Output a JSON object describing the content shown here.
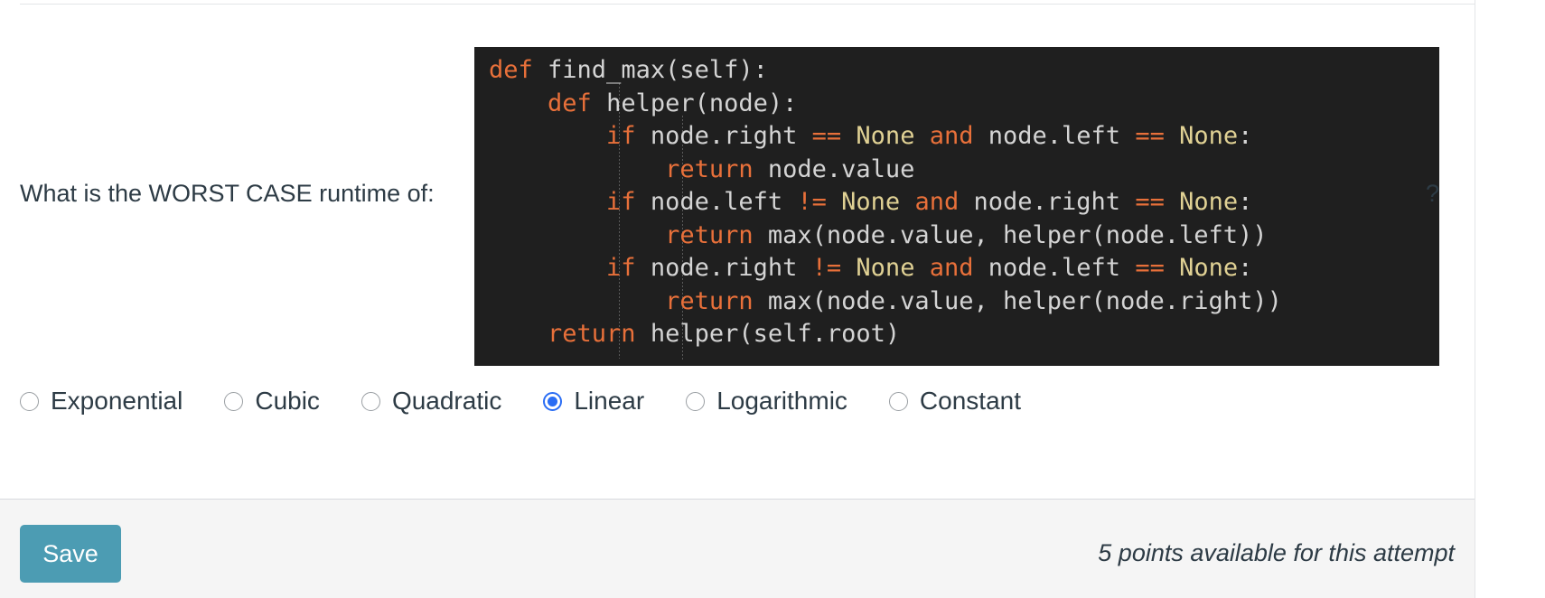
{
  "question": {
    "prefix": "What is the WORST CASE runtime of:",
    "suffix": "?"
  },
  "code": {
    "language": "python",
    "lines": [
      [
        {
          "t": "def",
          "c": "kw"
        },
        {
          "t": " find_max(self):",
          "c": "name"
        }
      ],
      [
        {
          "t": "    ",
          "c": "name"
        },
        {
          "t": "def",
          "c": "kw"
        },
        {
          "t": " helper(node):",
          "c": "name"
        }
      ],
      [
        {
          "t": "        ",
          "c": "name"
        },
        {
          "t": "if",
          "c": "kw"
        },
        {
          "t": " node.right ",
          "c": "name"
        },
        {
          "t": "==",
          "c": "op"
        },
        {
          "t": " ",
          "c": "name"
        },
        {
          "t": "None",
          "c": "none"
        },
        {
          "t": " ",
          "c": "name"
        },
        {
          "t": "and",
          "c": "kw"
        },
        {
          "t": " node.left ",
          "c": "name"
        },
        {
          "t": "==",
          "c": "op"
        },
        {
          "t": " ",
          "c": "name"
        },
        {
          "t": "None",
          "c": "none"
        },
        {
          "t": ":",
          "c": "name"
        }
      ],
      [
        {
          "t": "            ",
          "c": "name"
        },
        {
          "t": "return",
          "c": "kw"
        },
        {
          "t": " node.value",
          "c": "name"
        }
      ],
      [
        {
          "t": "        ",
          "c": "name"
        },
        {
          "t": "if",
          "c": "kw"
        },
        {
          "t": " node.left ",
          "c": "name"
        },
        {
          "t": "!=",
          "c": "op"
        },
        {
          "t": " ",
          "c": "name"
        },
        {
          "t": "None",
          "c": "none"
        },
        {
          "t": " ",
          "c": "name"
        },
        {
          "t": "and",
          "c": "kw"
        },
        {
          "t": " node.right ",
          "c": "name"
        },
        {
          "t": "==",
          "c": "op"
        },
        {
          "t": " ",
          "c": "name"
        },
        {
          "t": "None",
          "c": "none"
        },
        {
          "t": ":",
          "c": "name"
        }
      ],
      [
        {
          "t": "            ",
          "c": "name"
        },
        {
          "t": "return",
          "c": "kw"
        },
        {
          "t": " max(node.value, helper(node.left))",
          "c": "name"
        }
      ],
      [
        {
          "t": "        ",
          "c": "name"
        },
        {
          "t": "if",
          "c": "kw"
        },
        {
          "t": " node.right ",
          "c": "name"
        },
        {
          "t": "!=",
          "c": "op"
        },
        {
          "t": " ",
          "c": "name"
        },
        {
          "t": "None",
          "c": "none"
        },
        {
          "t": " ",
          "c": "name"
        },
        {
          "t": "and",
          "c": "kw"
        },
        {
          "t": " node.left ",
          "c": "name"
        },
        {
          "t": "==",
          "c": "op"
        },
        {
          "t": " ",
          "c": "name"
        },
        {
          "t": "None",
          "c": "none"
        },
        {
          "t": ":",
          "c": "name"
        }
      ],
      [
        {
          "t": "            ",
          "c": "name"
        },
        {
          "t": "return",
          "c": "kw"
        },
        {
          "t": " max(node.value, helper(node.right))",
          "c": "name"
        }
      ],
      [
        {
          "t": "    ",
          "c": "name"
        },
        {
          "t": "return",
          "c": "kw"
        },
        {
          "t": " helper(self.root)",
          "c": "name"
        }
      ]
    ],
    "plain_text": "def find_max(self):\n    def helper(node):\n        if node.right == None and node.left == None:\n            return node.value\n        if node.left != None and node.right == None:\n            return max(node.value, helper(node.left))\n        if node.right != None and node.left == None:\n            return max(node.value, helper(node.right))\n    return helper(self.root)",
    "theme": {
      "background": "#1f1f1f",
      "text": "#d4d4d4",
      "keyword": "#e8703a",
      "constant": "#e0d194",
      "operator": "#e8703a"
    }
  },
  "answers": {
    "options": [
      {
        "label": "Exponential",
        "selected": false
      },
      {
        "label": "Cubic",
        "selected": false
      },
      {
        "label": "Quadratic",
        "selected": false
      },
      {
        "label": "Linear",
        "selected": true
      },
      {
        "label": "Logarithmic",
        "selected": false
      },
      {
        "label": "Constant",
        "selected": false
      }
    ],
    "selected_value": "Linear",
    "accent_color": "#2a6df4"
  },
  "footer": {
    "save_label": "Save",
    "save_color": "#4c9cb3",
    "points_note": "5 points available for this attempt"
  }
}
